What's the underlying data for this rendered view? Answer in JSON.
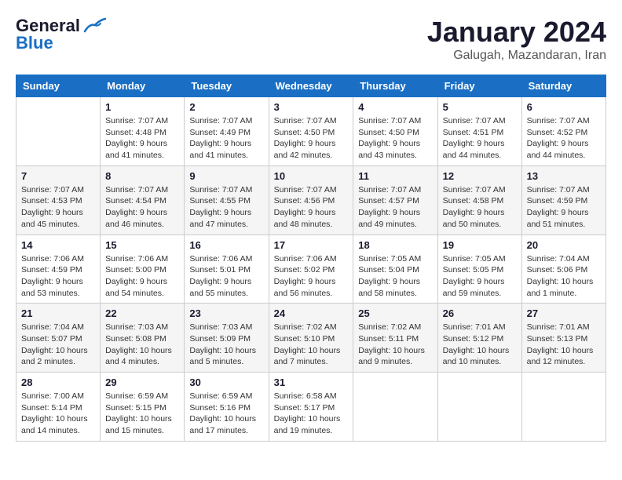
{
  "header": {
    "logo_line1": "General",
    "logo_line2": "Blue",
    "title": "January 2024",
    "subtitle": "Galugah, Mazandaran, Iran"
  },
  "days_of_week": [
    "Sunday",
    "Monday",
    "Tuesday",
    "Wednesday",
    "Thursday",
    "Friday",
    "Saturday"
  ],
  "weeks": [
    [
      {
        "day": "",
        "sunrise": "",
        "sunset": "",
        "daylight": ""
      },
      {
        "day": "1",
        "sunrise": "Sunrise: 7:07 AM",
        "sunset": "Sunset: 4:48 PM",
        "daylight": "Daylight: 9 hours and 41 minutes."
      },
      {
        "day": "2",
        "sunrise": "Sunrise: 7:07 AM",
        "sunset": "Sunset: 4:49 PM",
        "daylight": "Daylight: 9 hours and 41 minutes."
      },
      {
        "day": "3",
        "sunrise": "Sunrise: 7:07 AM",
        "sunset": "Sunset: 4:50 PM",
        "daylight": "Daylight: 9 hours and 42 minutes."
      },
      {
        "day": "4",
        "sunrise": "Sunrise: 7:07 AM",
        "sunset": "Sunset: 4:50 PM",
        "daylight": "Daylight: 9 hours and 43 minutes."
      },
      {
        "day": "5",
        "sunrise": "Sunrise: 7:07 AM",
        "sunset": "Sunset: 4:51 PM",
        "daylight": "Daylight: 9 hours and 44 minutes."
      },
      {
        "day": "6",
        "sunrise": "Sunrise: 7:07 AM",
        "sunset": "Sunset: 4:52 PM",
        "daylight": "Daylight: 9 hours and 44 minutes."
      }
    ],
    [
      {
        "day": "7",
        "sunrise": "Sunrise: 7:07 AM",
        "sunset": "Sunset: 4:53 PM",
        "daylight": "Daylight: 9 hours and 45 minutes."
      },
      {
        "day": "8",
        "sunrise": "Sunrise: 7:07 AM",
        "sunset": "Sunset: 4:54 PM",
        "daylight": "Daylight: 9 hours and 46 minutes."
      },
      {
        "day": "9",
        "sunrise": "Sunrise: 7:07 AM",
        "sunset": "Sunset: 4:55 PM",
        "daylight": "Daylight: 9 hours and 47 minutes."
      },
      {
        "day": "10",
        "sunrise": "Sunrise: 7:07 AM",
        "sunset": "Sunset: 4:56 PM",
        "daylight": "Daylight: 9 hours and 48 minutes."
      },
      {
        "day": "11",
        "sunrise": "Sunrise: 7:07 AM",
        "sunset": "Sunset: 4:57 PM",
        "daylight": "Daylight: 9 hours and 49 minutes."
      },
      {
        "day": "12",
        "sunrise": "Sunrise: 7:07 AM",
        "sunset": "Sunset: 4:58 PM",
        "daylight": "Daylight: 9 hours and 50 minutes."
      },
      {
        "day": "13",
        "sunrise": "Sunrise: 7:07 AM",
        "sunset": "Sunset: 4:59 PM",
        "daylight": "Daylight: 9 hours and 51 minutes."
      }
    ],
    [
      {
        "day": "14",
        "sunrise": "Sunrise: 7:06 AM",
        "sunset": "Sunset: 4:59 PM",
        "daylight": "Daylight: 9 hours and 53 minutes."
      },
      {
        "day": "15",
        "sunrise": "Sunrise: 7:06 AM",
        "sunset": "Sunset: 5:00 PM",
        "daylight": "Daylight: 9 hours and 54 minutes."
      },
      {
        "day": "16",
        "sunrise": "Sunrise: 7:06 AM",
        "sunset": "Sunset: 5:01 PM",
        "daylight": "Daylight: 9 hours and 55 minutes."
      },
      {
        "day": "17",
        "sunrise": "Sunrise: 7:06 AM",
        "sunset": "Sunset: 5:02 PM",
        "daylight": "Daylight: 9 hours and 56 minutes."
      },
      {
        "day": "18",
        "sunrise": "Sunrise: 7:05 AM",
        "sunset": "Sunset: 5:04 PM",
        "daylight": "Daylight: 9 hours and 58 minutes."
      },
      {
        "day": "19",
        "sunrise": "Sunrise: 7:05 AM",
        "sunset": "Sunset: 5:05 PM",
        "daylight": "Daylight: 9 hours and 59 minutes."
      },
      {
        "day": "20",
        "sunrise": "Sunrise: 7:04 AM",
        "sunset": "Sunset: 5:06 PM",
        "daylight": "Daylight: 10 hours and 1 minute."
      }
    ],
    [
      {
        "day": "21",
        "sunrise": "Sunrise: 7:04 AM",
        "sunset": "Sunset: 5:07 PM",
        "daylight": "Daylight: 10 hours and 2 minutes."
      },
      {
        "day": "22",
        "sunrise": "Sunrise: 7:03 AM",
        "sunset": "Sunset: 5:08 PM",
        "daylight": "Daylight: 10 hours and 4 minutes."
      },
      {
        "day": "23",
        "sunrise": "Sunrise: 7:03 AM",
        "sunset": "Sunset: 5:09 PM",
        "daylight": "Daylight: 10 hours and 5 minutes."
      },
      {
        "day": "24",
        "sunrise": "Sunrise: 7:02 AM",
        "sunset": "Sunset: 5:10 PM",
        "daylight": "Daylight: 10 hours and 7 minutes."
      },
      {
        "day": "25",
        "sunrise": "Sunrise: 7:02 AM",
        "sunset": "Sunset: 5:11 PM",
        "daylight": "Daylight: 10 hours and 9 minutes."
      },
      {
        "day": "26",
        "sunrise": "Sunrise: 7:01 AM",
        "sunset": "Sunset: 5:12 PM",
        "daylight": "Daylight: 10 hours and 10 minutes."
      },
      {
        "day": "27",
        "sunrise": "Sunrise: 7:01 AM",
        "sunset": "Sunset: 5:13 PM",
        "daylight": "Daylight: 10 hours and 12 minutes."
      }
    ],
    [
      {
        "day": "28",
        "sunrise": "Sunrise: 7:00 AM",
        "sunset": "Sunset: 5:14 PM",
        "daylight": "Daylight: 10 hours and 14 minutes."
      },
      {
        "day": "29",
        "sunrise": "Sunrise: 6:59 AM",
        "sunset": "Sunset: 5:15 PM",
        "daylight": "Daylight: 10 hours and 15 minutes."
      },
      {
        "day": "30",
        "sunrise": "Sunrise: 6:59 AM",
        "sunset": "Sunset: 5:16 PM",
        "daylight": "Daylight: 10 hours and 17 minutes."
      },
      {
        "day": "31",
        "sunrise": "Sunrise: 6:58 AM",
        "sunset": "Sunset: 5:17 PM",
        "daylight": "Daylight: 10 hours and 19 minutes."
      },
      {
        "day": "",
        "sunrise": "",
        "sunset": "",
        "daylight": ""
      },
      {
        "day": "",
        "sunrise": "",
        "sunset": "",
        "daylight": ""
      },
      {
        "day": "",
        "sunrise": "",
        "sunset": "",
        "daylight": ""
      }
    ]
  ]
}
